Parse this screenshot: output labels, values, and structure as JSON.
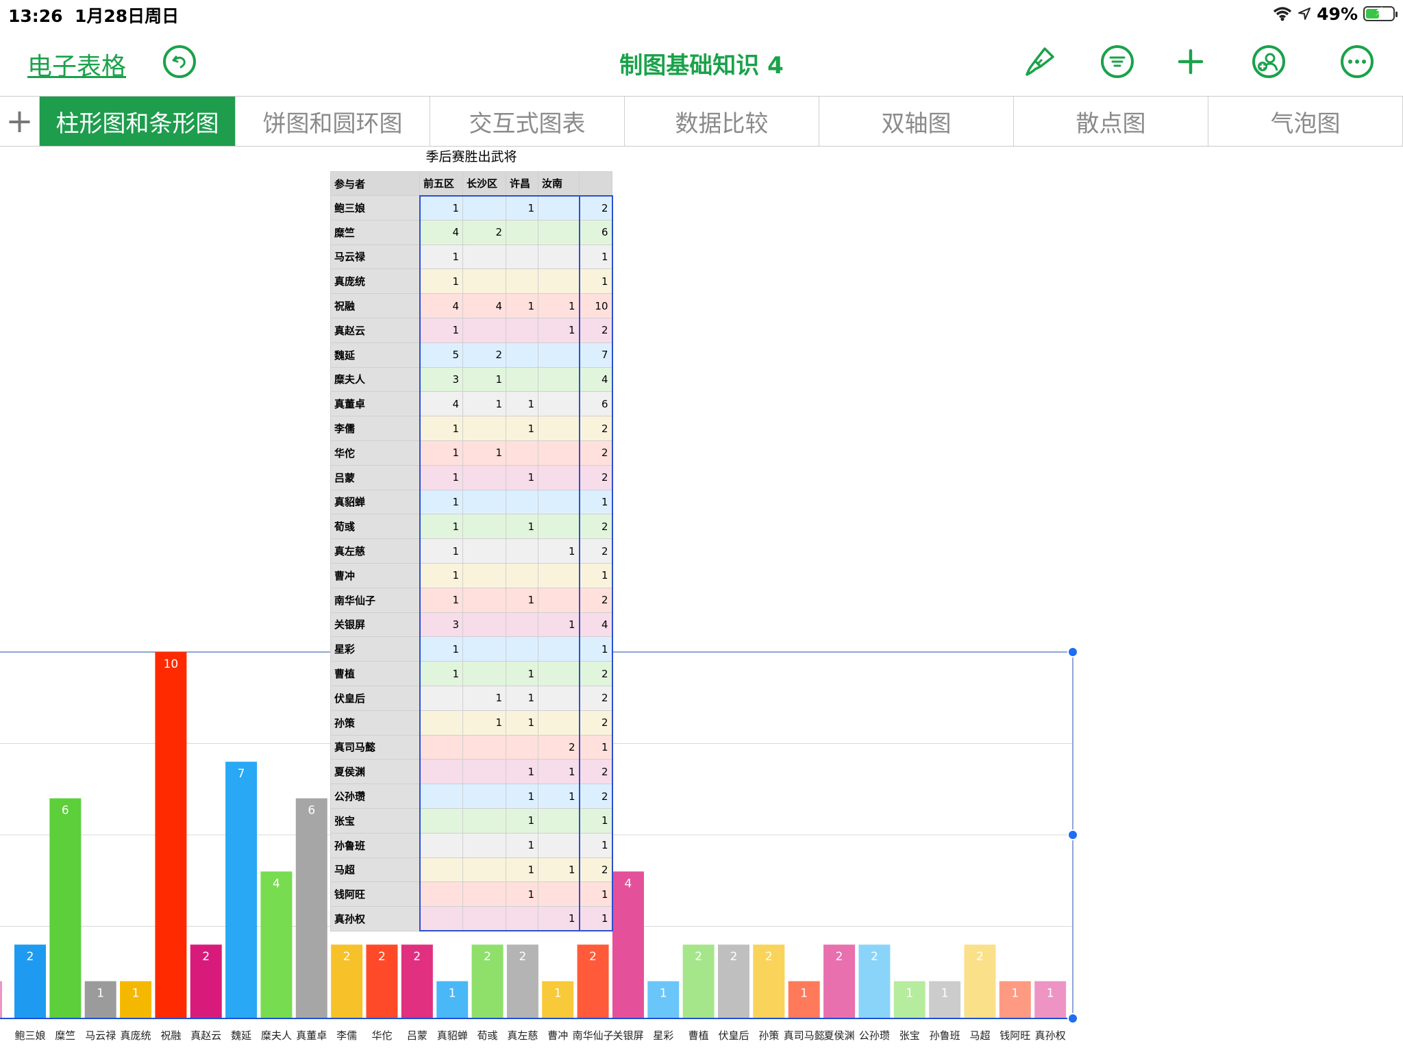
{
  "status_bar": {
    "time": "13:26",
    "date": "1月28日周日",
    "battery": "49%",
    "battery_level": 0.49
  },
  "toolbar": {
    "back_label": "电子表格",
    "title": "制图基础知识 4"
  },
  "tabs": {
    "add_label": "+",
    "items": [
      "柱形图和条形图",
      "饼图和圆环图",
      "交互式图表",
      "数据比较",
      "双轴图",
      "散点图",
      "气泡图"
    ],
    "active_index": 0
  },
  "table": {
    "title": "季后赛胜出武将",
    "headers": [
      "参与者",
      "前五区",
      "长沙区",
      "许昌",
      "汝南",
      ""
    ],
    "rows": [
      [
        "鲍三娘",
        "1",
        "",
        "1",
        "",
        "2"
      ],
      [
        "糜竺",
        "4",
        "2",
        "",
        "",
        "6"
      ],
      [
        "马云禄",
        "1",
        "",
        "",
        "",
        "1"
      ],
      [
        "真庞统",
        "1",
        "",
        "",
        "",
        "1"
      ],
      [
        "祝融",
        "4",
        "4",
        "1",
        "1",
        "10"
      ],
      [
        "真赵云",
        "1",
        "",
        "",
        "1",
        "2"
      ],
      [
        "魏延",
        "5",
        "2",
        "",
        "",
        "7"
      ],
      [
        "糜夫人",
        "3",
        "1",
        "",
        "",
        "4"
      ],
      [
        "真董卓",
        "4",
        "1",
        "1",
        "",
        "6"
      ],
      [
        "李儒",
        "1",
        "",
        "1",
        "",
        "2"
      ],
      [
        "华佗",
        "1",
        "1",
        "",
        "",
        "2"
      ],
      [
        "吕蒙",
        "1",
        "",
        "1",
        "",
        "2"
      ],
      [
        "真貂蝉",
        "1",
        "",
        "",
        "",
        "1"
      ],
      [
        "荀彧",
        "1",
        "",
        "1",
        "",
        "2"
      ],
      [
        "真左慈",
        "1",
        "",
        "",
        "1",
        "2"
      ],
      [
        "曹冲",
        "1",
        "",
        "",
        "",
        "1"
      ],
      [
        "南华仙子",
        "1",
        "",
        "1",
        "",
        "2"
      ],
      [
        "关银屏",
        "3",
        "",
        "",
        "1",
        "4"
      ],
      [
        "星彩",
        "1",
        "",
        "",
        "",
        "1"
      ],
      [
        "曹植",
        "1",
        "",
        "1",
        "",
        "2"
      ],
      [
        "伏皇后",
        "",
        "1",
        "1",
        "",
        "2"
      ],
      [
        "孙策",
        "",
        "1",
        "1",
        "",
        "2"
      ],
      [
        "真司马懿",
        "",
        "",
        "",
        "2",
        "1"
      ],
      [
        "夏侯渊",
        "",
        "",
        "1",
        "1",
        "2"
      ],
      [
        "公孙瓒",
        "",
        "",
        "1",
        "1",
        "2"
      ],
      [
        "张宝",
        "",
        "",
        "1",
        "",
        "1"
      ],
      [
        "孙鲁班",
        "",
        "",
        "1",
        "",
        "1"
      ],
      [
        "马超",
        "",
        "",
        "1",
        "1",
        "2"
      ],
      [
        "钱阿旺",
        "",
        "",
        "1",
        "",
        "1"
      ],
      [
        "真孙权",
        "",
        "",
        "",
        "1",
        "1"
      ]
    ],
    "row_colors": [
      "#dcefff",
      "#e1f5dc",
      "#f0f0f0",
      "#faf3dc",
      "#ffe0dc",
      "#f7dcea"
    ]
  },
  "chart_data": {
    "type": "bar",
    "ylim": [
      0,
      10
    ],
    "grid": true,
    "categories": [
      "鲍三娘",
      "糜竺",
      "马云禄",
      "真庞统",
      "祝融",
      "真赵云",
      "魏延",
      "糜夫人",
      "真董卓",
      "李儒",
      "华佗",
      "吕蒙",
      "真貂蝉",
      "荀彧",
      "真左慈",
      "曹冲",
      "南华仙子",
      "关银屏",
      "星彩",
      "曹植",
      "伏皇后",
      "孙策",
      "真司马懿",
      "夏侯渊",
      "公孙瓒",
      "张宝",
      "孙鲁班",
      "马超",
      "钱阿旺",
      "真孙权"
    ],
    "values": [
      2,
      6,
      1,
      1,
      10,
      2,
      7,
      4,
      6,
      2,
      2,
      2,
      1,
      2,
      2,
      1,
      2,
      4,
      1,
      2,
      2,
      2,
      1,
      2,
      2,
      1,
      1,
      2,
      1,
      1
    ],
    "colors": [
      "#1e9bf0",
      "#5ccf3a",
      "#9b9b9b",
      "#f5b800",
      "#ff2a00",
      "#d81b7a",
      "#28a8f5",
      "#78dc50",
      "#a6a6a6",
      "#f7c12a",
      "#ff4a2a",
      "#e0307f",
      "#4ab8f7",
      "#8ee06a",
      "#b4b4b4",
      "#f8c938",
      "#ff5a3a",
      "#e4509a",
      "#6ac6f8",
      "#a6e68a",
      "#bfbfbf",
      "#f9d35a",
      "#ff7a5a",
      "#e870ae",
      "#8ad4fa",
      "#b6ec9e",
      "#cccccc",
      "#fbe08a",
      "#ff9a82",
      "#ee94c4"
    ]
  }
}
